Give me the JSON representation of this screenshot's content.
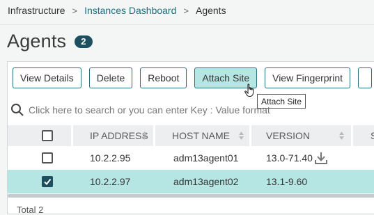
{
  "breadcrumb": {
    "items": [
      "Infrastructure",
      "Instances Dashboard",
      "Agents"
    ],
    "separator": ">"
  },
  "page": {
    "title": "Agents",
    "count": "2"
  },
  "toolbar": {
    "buttons": [
      "View Details",
      "Delete",
      "Reboot",
      "Attach Site",
      "View Fingerprint"
    ],
    "hovered": "Attach Site"
  },
  "tooltip": {
    "text": "Attach Site"
  },
  "search": {
    "placeholder": "Click here to search or you can enter Key : Value format",
    "icon": "search-icon"
  },
  "table": {
    "columns": [
      "IP ADDRESS",
      "HOST NAME",
      "VERSION",
      "S"
    ],
    "rows": [
      {
        "ip": "10.2.2.95",
        "host": "adm13agent01",
        "version": "13.0-71.40",
        "selected": false,
        "action_icon": "download-icon"
      },
      {
        "ip": "10.2.2.97",
        "host": "adm13agent02",
        "version": "13.1-9.60",
        "selected": true
      }
    ]
  },
  "footer": {
    "total": "Total  2"
  },
  "colors": {
    "accent": "#1d4f61",
    "link": "#1c6e7d",
    "selected_row": "#b5e6e4",
    "button_border": "#2a6d7c"
  }
}
